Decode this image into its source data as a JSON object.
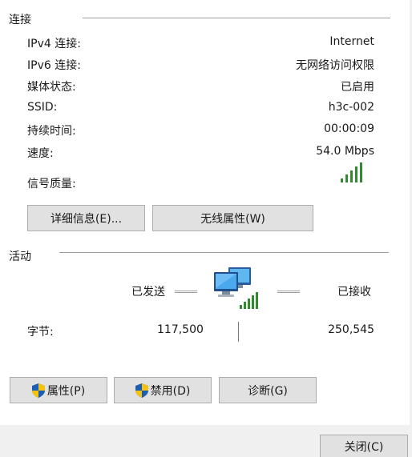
{
  "connection": {
    "section_title": "连接",
    "rows": [
      {
        "label": "IPv4 连接:",
        "value": "Internet"
      },
      {
        "label": "IPv6 连接:",
        "value": "无网络访问权限"
      },
      {
        "label": "媒体状态:",
        "value": "已启用"
      },
      {
        "label": "SSID:",
        "value": "h3c-002"
      },
      {
        "label": "持续时间:",
        "value": "00:00:09"
      },
      {
        "label": "速度:",
        "value": "54.0 Mbps"
      }
    ],
    "signal_label": "信号质量:",
    "signal_icon": "wifi-signal-strength-icon",
    "signal_bars": 5,
    "details_button": "详细信息(E)...",
    "wireless_props_button": "无线属性(W)"
  },
  "activity": {
    "section_title": "活动",
    "sent_label": "已发送",
    "received_label": "已接收",
    "bytes_label": "字节:",
    "bytes_sent": "117,500",
    "bytes_received": "250,545",
    "network_icon": "network-computers-icon"
  },
  "buttons": {
    "properties": "属性(P)",
    "disable": "禁用(D)",
    "diagnose": "诊断(G)",
    "close": "关闭(C)"
  },
  "colors": {
    "signal_green": "#2e8b2e",
    "button_bg": "#e1e1e1",
    "footer_bg": "#f0f0f0"
  }
}
